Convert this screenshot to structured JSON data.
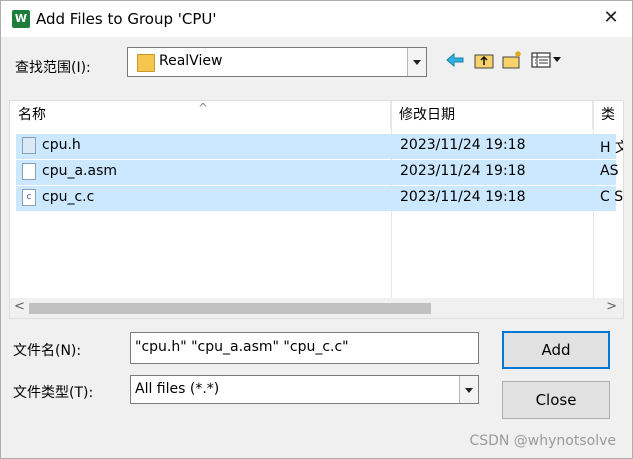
{
  "window": {
    "title": "Add Files to Group 'CPU'",
    "app_icon_text": "W"
  },
  "look_in": {
    "label": "查找范围(I):",
    "value": "RealView"
  },
  "toolbar": {
    "back_icon": "back-arrow-icon",
    "up_icon": "up-folder-icon",
    "new_folder_icon": "new-folder-icon",
    "view_icon": "view-menu-icon"
  },
  "columns": {
    "name": "名称",
    "date": "修改日期",
    "type": "类"
  },
  "files": [
    {
      "name": "cpu.h",
      "date": "2023/11/24 19:18",
      "type": "H 文",
      "icon": "header-file-icon"
    },
    {
      "name": "cpu_a.asm",
      "date": "2023/11/24 19:18",
      "type": "AS",
      "icon": "asm-file-icon"
    },
    {
      "name": "cpu_c.c",
      "date": "2023/11/24 19:18",
      "type": "C S",
      "icon": "c-file-icon"
    }
  ],
  "filename": {
    "label": "文件名(N):",
    "value": "\"cpu.h\" \"cpu_a.asm\" \"cpu_c.c\""
  },
  "filetype": {
    "label": "文件类型(T):",
    "value": "All files (*.*)"
  },
  "buttons": {
    "add": "Add",
    "close": "Close"
  },
  "watermark": "CSDN @whynotsolve"
}
